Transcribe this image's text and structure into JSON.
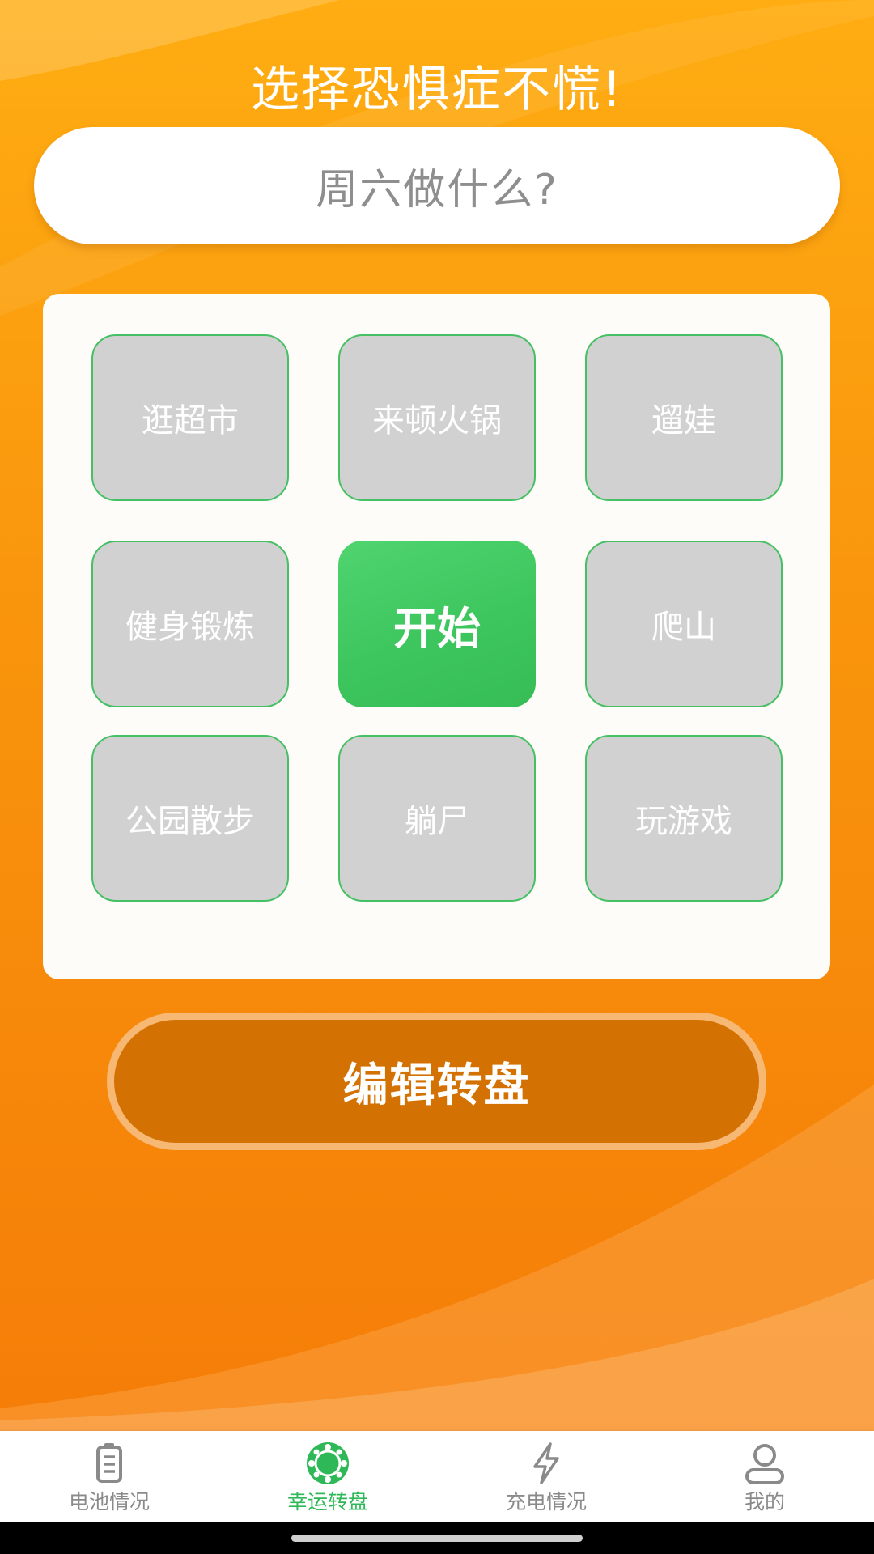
{
  "header": {
    "title": "选择恐惧症不慌!"
  },
  "question": {
    "text": "周六做什么?"
  },
  "grid": {
    "cells": [
      {
        "label": "逛超市"
      },
      {
        "label": "来顿火锅"
      },
      {
        "label": "遛娃"
      },
      {
        "label": "健身锻炼"
      },
      {
        "label": "开始"
      },
      {
        "label": "爬山"
      },
      {
        "label": "公园散步"
      },
      {
        "label": "躺尸"
      },
      {
        "label": "玩游戏"
      }
    ]
  },
  "actions": {
    "edit_label": "编辑转盘"
  },
  "tabbar": {
    "active_index": 1,
    "items": [
      {
        "label": "电池情况",
        "icon": "battery-icon"
      },
      {
        "label": "幸运转盘",
        "icon": "lucky-wheel-icon"
      },
      {
        "label": "充电情况",
        "icon": "lightning-icon"
      },
      {
        "label": "我的",
        "icon": "user-icon"
      }
    ]
  },
  "colors": {
    "accent_green": "#3ec65e",
    "background_orange": "#f9960d",
    "edit_button": "#d47103",
    "cell_gray": "#d1d1d1"
  }
}
